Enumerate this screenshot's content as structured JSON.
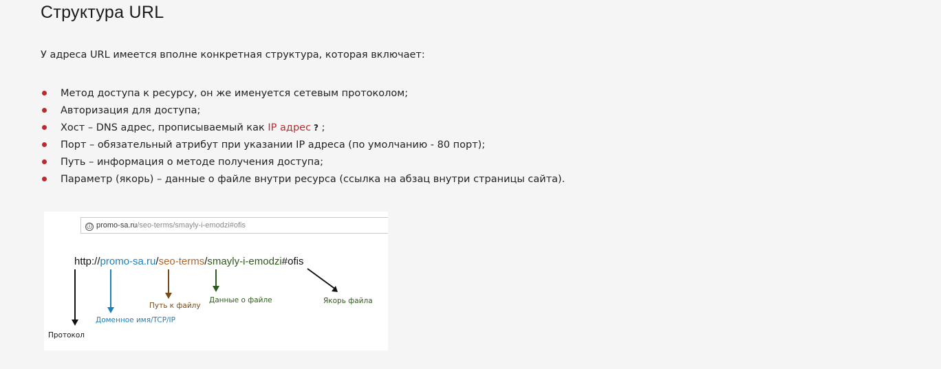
{
  "heading": "Структура URL",
  "intro": "У адреса URL имеется вполне конкретная структура, которая включает:",
  "items": [
    "Метод доступа к ресурсу, он же именуется сетевым протоколом;",
    "Авторизация для доступа;",
    {
      "prefix": "Хост – DNS адрес, прописываемый как ",
      "link": "IP адрес",
      "help": "?",
      "suffix": " ;"
    },
    "Порт – обязательный атрибут при указании IP адреса (по умолчанию - 80 порт);",
    "Путь – информация о методе получения доступа;",
    "Параметр (якорь) – данные о файле внутри ресурса (ссылка на абзац внутри страницы сайта)."
  ],
  "figure": {
    "address_bar": {
      "info_icon": "ⓘ",
      "domain": "promo-sa.ru",
      "path": "/seo-terms/smayly-i-emodzi#ofis"
    },
    "url_parts": {
      "scheme": "http://",
      "domain": "promo-sa.ru",
      "slash1": "/",
      "path": "seo-terms",
      "slash2": "/",
      "file": "smayly-i-emodzi",
      "anchor": "#ofis"
    },
    "labels": {
      "protocol": "Протокол",
      "domain": "Доменное имя/TCP/IP",
      "path": "Путь к файлу",
      "file": "Данные о файле",
      "anchor": "Якорь файла"
    },
    "colors": {
      "bullet": "#c0282d",
      "domain": "#1f7fb8",
      "path": "#b2632a",
      "file": "#2f5a1d",
      "protocol": "#111111"
    }
  }
}
